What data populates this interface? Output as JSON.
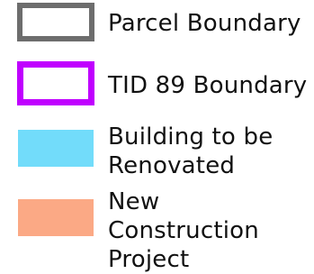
{
  "legend": {
    "items": [
      {
        "label": "Parcel Boundary",
        "symbol": "outline",
        "color": "#6d6d6d"
      },
      {
        "label": "TID 89 Boundary",
        "symbol": "outline",
        "color": "#c000ff"
      },
      {
        "label": "Building to be\nRenovated",
        "symbol": "fill",
        "color": "#72dcfa"
      },
      {
        "label": "New Construction\nProject",
        "symbol": "fill",
        "color": "#fba985"
      }
    ]
  }
}
